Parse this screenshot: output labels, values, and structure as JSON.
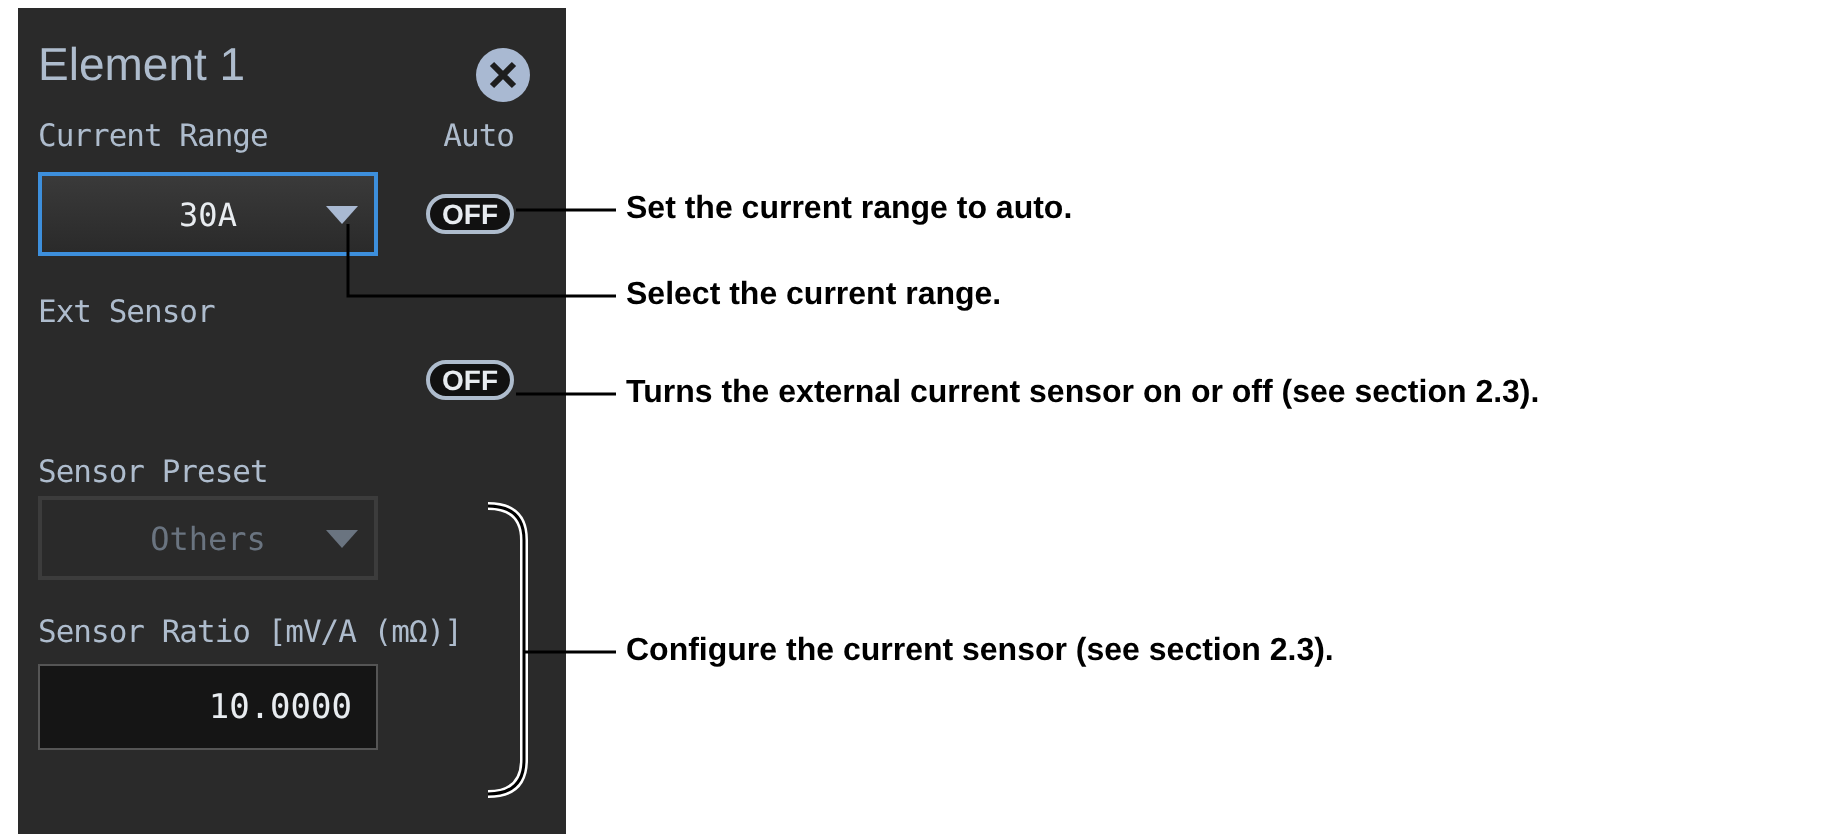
{
  "panel": {
    "title": "Element 1",
    "current_range": {
      "label": "Current Range",
      "value": "30A",
      "disabled": false,
      "focused": true
    },
    "auto": {
      "label": "Auto",
      "toggle": "OFF",
      "on": false
    },
    "ext_sensor": {
      "label": "Ext Sensor",
      "toggle": "OFF",
      "on": false
    },
    "sensor_preset": {
      "label": "Sensor Preset",
      "value": "Others",
      "disabled": true
    },
    "sensor_ratio": {
      "label": "Sensor Ratio [mV/A (mΩ)]",
      "value": "10.0000"
    }
  },
  "callouts": [
    {
      "text": "Set the current range to auto.",
      "kind": "straight"
    },
    {
      "text": "Select the current range.",
      "kind": "elbow"
    },
    {
      "text": "Turns the external current sensor on or off (see section 2.3).",
      "kind": "straight"
    },
    {
      "text": "Configure the current sensor (see section 2.3).",
      "kind": "bracket"
    }
  ]
}
